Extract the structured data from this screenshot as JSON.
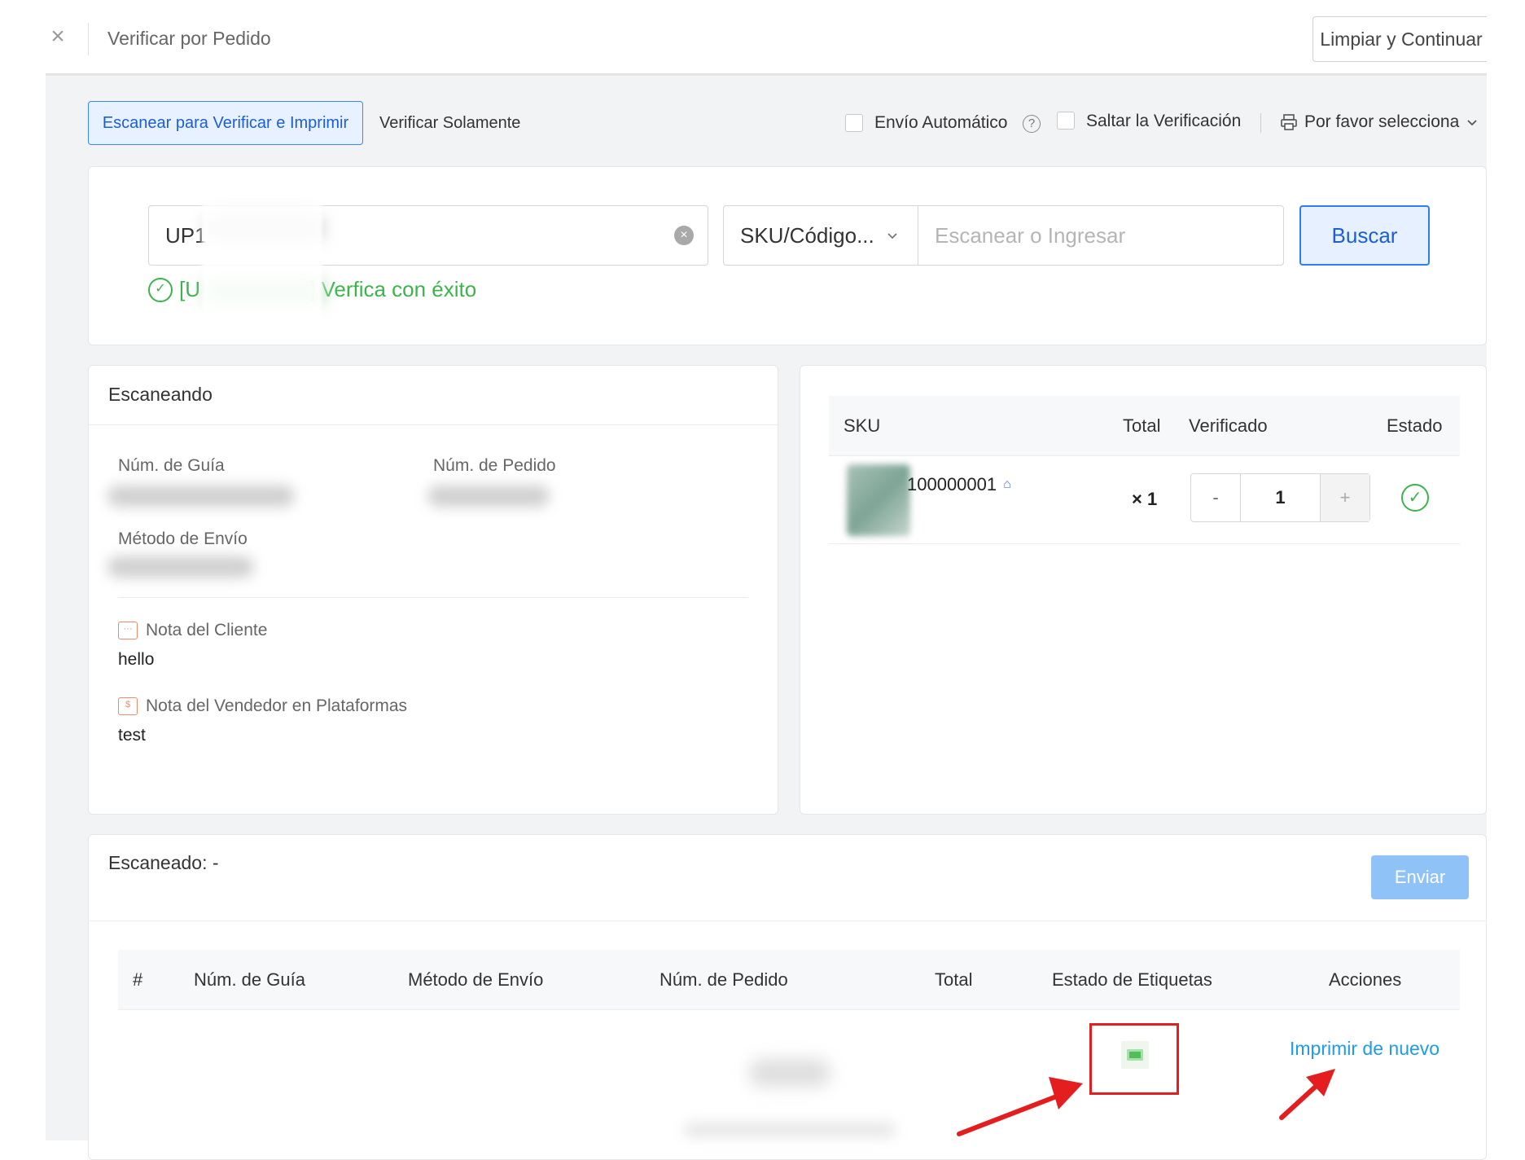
{
  "topbar": {
    "close_icon": "close-icon",
    "title": "Verificar por Pedido",
    "clear_button": "Limpiar y Continuar"
  },
  "mode": {
    "tabs": [
      {
        "label": "Escanear para Verificar e Imprimir",
        "active": true
      },
      {
        "label": "Verificar Solamente",
        "active": false
      }
    ],
    "auto_ship_label": "Envío Automático",
    "skip_verify_label": "Saltar la Verificación",
    "printer_placeholder": "Por favor selecciona"
  },
  "search": {
    "scan_value": "UP1",
    "success_prefix": "[U",
    "success_suffix": "] Verfica con éxito",
    "sku_type": "SKU/Código...",
    "sku_placeholder": "Escanear o Ingresar",
    "search_button": "Buscar"
  },
  "scanning": {
    "title": "Escaneando",
    "tracking_label": "Núm. de Guía",
    "order_label": "Núm. de Pedido",
    "shipping_label": "Método de Envío",
    "customer_note_label": "Nota del Cliente",
    "customer_note": "hello",
    "seller_note_label": "Nota del Vendedor en Plataformas",
    "seller_note": "test"
  },
  "sku_table": {
    "headers": {
      "sku": "SKU",
      "total": "Total",
      "verified": "Verificado",
      "status": "Estado"
    },
    "rows": [
      {
        "sku": "100000001",
        "total": "× 1",
        "verified": "1",
        "minus": "-",
        "plus": "+"
      }
    ]
  },
  "scanned": {
    "title": "Escaneado: -",
    "send_button": "Enviar",
    "headers": [
      "#",
      "Núm. de Guía",
      "Método de Envío",
      "Núm. de Pedido",
      "Total",
      "Estado de Etiquetas",
      "Acciones"
    ],
    "reprint_link": "Imprimir de nuevo"
  },
  "colors": {
    "primary": "#2f7df6",
    "success": "#3cb44b",
    "link": "#1e9bea",
    "annotation_red": "#e41e1e"
  }
}
